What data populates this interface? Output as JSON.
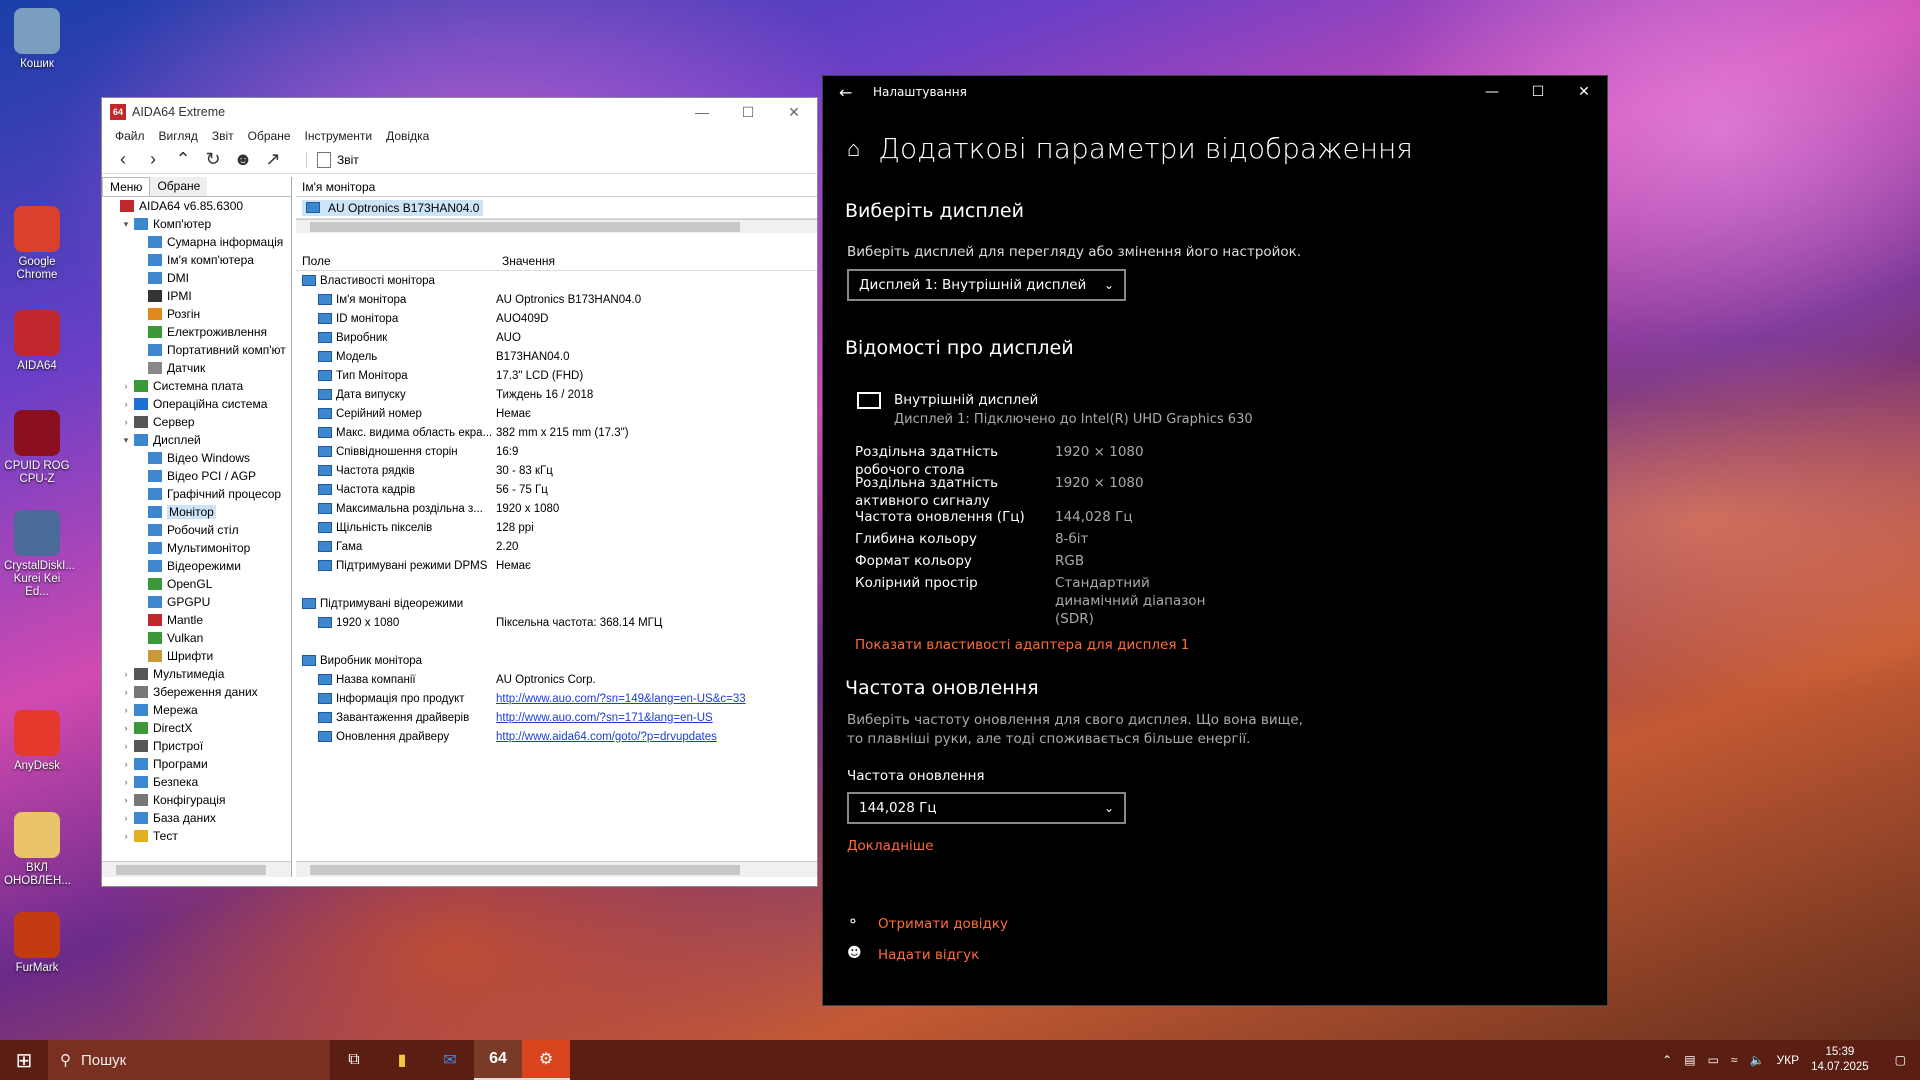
{
  "desktop": {
    "icons": [
      {
        "label": "Кошик",
        "icon": "recycle-bin-icon",
        "color": "#7a9ec0"
      },
      {
        "label": "Google Chrome",
        "icon": "chrome-icon",
        "color": "#d9412e"
      },
      {
        "label": "AIDA64",
        "icon": "aida64-icon",
        "color": "#c0282d"
      },
      {
        "label": "CPUID ROG CPU-Z",
        "icon": "cpuz-icon",
        "color": "#8a1020"
      },
      {
        "label": "CrystalDiskI... Kurei Kei Ed...",
        "icon": "crystaldisk-icon",
        "color": "#4a6a9a"
      },
      {
        "label": "AnyDesk",
        "icon": "anydesk-icon",
        "color": "#e5392d"
      },
      {
        "label": "ВКЛ ОНОВЛЕН...",
        "icon": "folder-icon",
        "color": "#e9c46a"
      },
      {
        "label": "FurMark",
        "icon": "furmark-icon",
        "color": "#c33b12"
      }
    ]
  },
  "aida": {
    "title": "AIDA64 Extreme",
    "app_icon": "64",
    "menu": [
      "Файл",
      "Вигляд",
      "Звіт",
      "Обране",
      "Інструменти",
      "Довідка"
    ],
    "toolbar": {
      "report_label": "Звіт"
    },
    "tabs": [
      "Меню",
      "Обране"
    ],
    "tree": [
      {
        "label": "AIDA64 v6.85.6300",
        "level": 0,
        "exp": "",
        "color": "#c0282d"
      },
      {
        "label": "Комп'ютер",
        "level": 1,
        "exp": "▾",
        "color": "#3d86d0"
      },
      {
        "label": "Сумарна інформація",
        "level": 2,
        "exp": "",
        "color": "#3d86d0"
      },
      {
        "label": "Ім'я комп'ютера",
        "level": 2,
        "exp": "",
        "color": "#3d86d0"
      },
      {
        "label": "DMI",
        "level": 2,
        "exp": "",
        "color": "#3d86d0"
      },
      {
        "label": "IPMI",
        "level": 2,
        "exp": "",
        "color": "#333"
      },
      {
        "label": "Розгін",
        "level": 2,
        "exp": "",
        "color": "#e08a1e"
      },
      {
        "label": "Електроживлення",
        "level": 2,
        "exp": "",
        "color": "#3a9a3a"
      },
      {
        "label": "Портативний комп'ют",
        "level": 2,
        "exp": "",
        "color": "#3d86d0"
      },
      {
        "label": "Датчик",
        "level": 2,
        "exp": "",
        "color": "#888"
      },
      {
        "label": "Системна плата",
        "level": 1,
        "exp": "›",
        "color": "#3a9a3a"
      },
      {
        "label": "Операційна система",
        "level": 1,
        "exp": "›",
        "color": "#1e6fd6"
      },
      {
        "label": "Сервер",
        "level": 1,
        "exp": "›",
        "color": "#555"
      },
      {
        "label": "Дисплей",
        "level": 1,
        "exp": "▾",
        "color": "#3d86d0"
      },
      {
        "label": "Відео Windows",
        "level": 2,
        "exp": "",
        "color": "#3d86d0"
      },
      {
        "label": "Відео PCI / AGP",
        "level": 2,
        "exp": "",
        "color": "#3d86d0"
      },
      {
        "label": "Графічний процесор",
        "level": 2,
        "exp": "",
        "color": "#3d86d0"
      },
      {
        "label": "Монітор",
        "level": 2,
        "exp": "",
        "color": "#3d86d0",
        "sel": true
      },
      {
        "label": "Робочий стіл",
        "level": 2,
        "exp": "",
        "color": "#3d86d0"
      },
      {
        "label": "Мультимонітор",
        "level": 2,
        "exp": "",
        "color": "#3d86d0"
      },
      {
        "label": "Відеорежими",
        "level": 2,
        "exp": "",
        "color": "#3d86d0"
      },
      {
        "label": "OpenGL",
        "level": 2,
        "exp": "",
        "color": "#3a9a3a"
      },
      {
        "label": "GPGPU",
        "level": 2,
        "exp": "",
        "color": "#3d86d0"
      },
      {
        "label": "Mantle",
        "level": 2,
        "exp": "",
        "color": "#c0282d"
      },
      {
        "label": "Vulkan",
        "level": 2,
        "exp": "",
        "color": "#3a9a3a"
      },
      {
        "label": "Шрифти",
        "level": 2,
        "exp": "",
        "color": "#c99a3a"
      },
      {
        "label": "Мультимедіа",
        "level": 1,
        "exp": "›",
        "color": "#555"
      },
      {
        "label": "Збереження даних",
        "level": 1,
        "exp": "›",
        "color": "#777"
      },
      {
        "label": "Мережа",
        "level": 1,
        "exp": "›",
        "color": "#3d86d0"
      },
      {
        "label": "DirectX",
        "level": 1,
        "exp": "›",
        "color": "#3a9a3a"
      },
      {
        "label": "Пристрої",
        "level": 1,
        "exp": "›",
        "color": "#555"
      },
      {
        "label": "Програми",
        "level": 1,
        "exp": "›",
        "color": "#3d86d0"
      },
      {
        "label": "Безпека",
        "level": 1,
        "exp": "›",
        "color": "#3d86d0"
      },
      {
        "label": "Конфігурація",
        "level": 1,
        "exp": "›",
        "color": "#777"
      },
      {
        "label": "База даних",
        "level": 1,
        "exp": "›",
        "color": "#3d86d0"
      },
      {
        "label": "Тест",
        "level": 1,
        "exp": "›",
        "color": "#e0b020"
      }
    ],
    "right": {
      "header": "Ім'я монітора",
      "device": "AU Optronics B173HAN04.0",
      "col_field": "Поле",
      "col_value": "Значення",
      "sections": [
        {
          "title": "Властивості монітора",
          "rows": [
            {
              "f": "Ім'я монітора",
              "v": "AU Optronics B173HAN04.0"
            },
            {
              "f": "ID монітора",
              "v": "AUO409D"
            },
            {
              "f": "Виробник",
              "v": "AUO"
            },
            {
              "f": "Модель",
              "v": "B173HAN04.0"
            },
            {
              "f": "Тип Монітора",
              "v": "17.3\" LCD (FHD)"
            },
            {
              "f": "Дата випуску",
              "v": "Тиждень 16 / 2018"
            },
            {
              "f": "Серійний номер",
              "v": "Немає"
            },
            {
              "f": "Макс. видима область екра...",
              "v": "382 mm x 215 mm (17.3\")"
            },
            {
              "f": "Співвідношення сторін",
              "v": "16:9"
            },
            {
              "f": "Частота рядків",
              "v": "30 - 83 кГц"
            },
            {
              "f": "Частота кадрів",
              "v": "56 - 75 Гц"
            },
            {
              "f": "Максимальна роздільна з...",
              "v": "1920 x 1080"
            },
            {
              "f": "Щільність пікселів",
              "v": "128 ppi"
            },
            {
              "f": "Гама",
              "v": "2.20"
            },
            {
              "f": "Підтримувані режими DPMS",
              "v": "Немає"
            }
          ]
        },
        {
          "title": "Підтримувані відеорежими",
          "rows": [
            {
              "f": "1920 x 1080",
              "v": "Піксельна частота: 368.14 МГЦ"
            }
          ]
        },
        {
          "title": "Виробник монітора",
          "rows": [
            {
              "f": "Назва компанії",
              "v": "AU Optronics Corp."
            },
            {
              "f": "Інформація про продукт",
              "v": "http://www.auo.com/?sn=149&lang=en-US&c=33",
              "link": true
            },
            {
              "f": "Завантаження драйверів",
              "v": "http://www.auo.com/?sn=171&lang=en-US",
              "link": true
            },
            {
              "f": "Оновлення драйверу",
              "v": "http://www.aida64.com/goto/?p=drvupdates",
              "link": true
            }
          ]
        }
      ]
    }
  },
  "settings": {
    "window_title": "Налаштування",
    "heading": "Додаткові параметри відображення",
    "choose_display_title": "Виберіть дисплей",
    "choose_display_desc": "Виберіть дисплей для перегляду або змінення його настройок.",
    "display_select": "Дисплей 1: Внутрішній дисплей",
    "info_title": "Відомості про дисплей",
    "display_name": "Внутрішній дисплей",
    "display_sub": "Дисплей 1: Підключено до Intel(R) UHD Graphics 630",
    "info": [
      {
        "k": "Роздільна здатність робочого стола",
        "v": "1920 × 1080"
      },
      {
        "k": "Роздільна здатність активного сигналу",
        "v": "1920 × 1080"
      },
      {
        "k": "Частота оновлення (Гц)",
        "v": "144,028 Гц"
      },
      {
        "k": "Глибина кольору",
        "v": "8-біт"
      },
      {
        "k": "Формат кольору",
        "v": "RGB"
      },
      {
        "k": "Колірний простір",
        "v": "Стандартний динамічний діапазон (SDR)"
      }
    ],
    "adapter_link": "Показати властивості адаптера для дисплея 1",
    "refresh_title": "Частота оновлення",
    "refresh_desc": "Виберіть частоту оновлення для свого дисплея. Що вона вище, то плавніші руки, але тоді споживається більше енергії.",
    "refresh_label": "Частота оновлення",
    "refresh_select": "144,028 Гц",
    "more_link": "Докладніше",
    "help_link": "Отримати довідку",
    "feedback_link": "Надати відгук",
    "accent": "#ff6b3a"
  },
  "taskbar": {
    "search_placeholder": "Пошук",
    "lang": "УКР",
    "time": "15:39",
    "date": "14.07.2025"
  }
}
